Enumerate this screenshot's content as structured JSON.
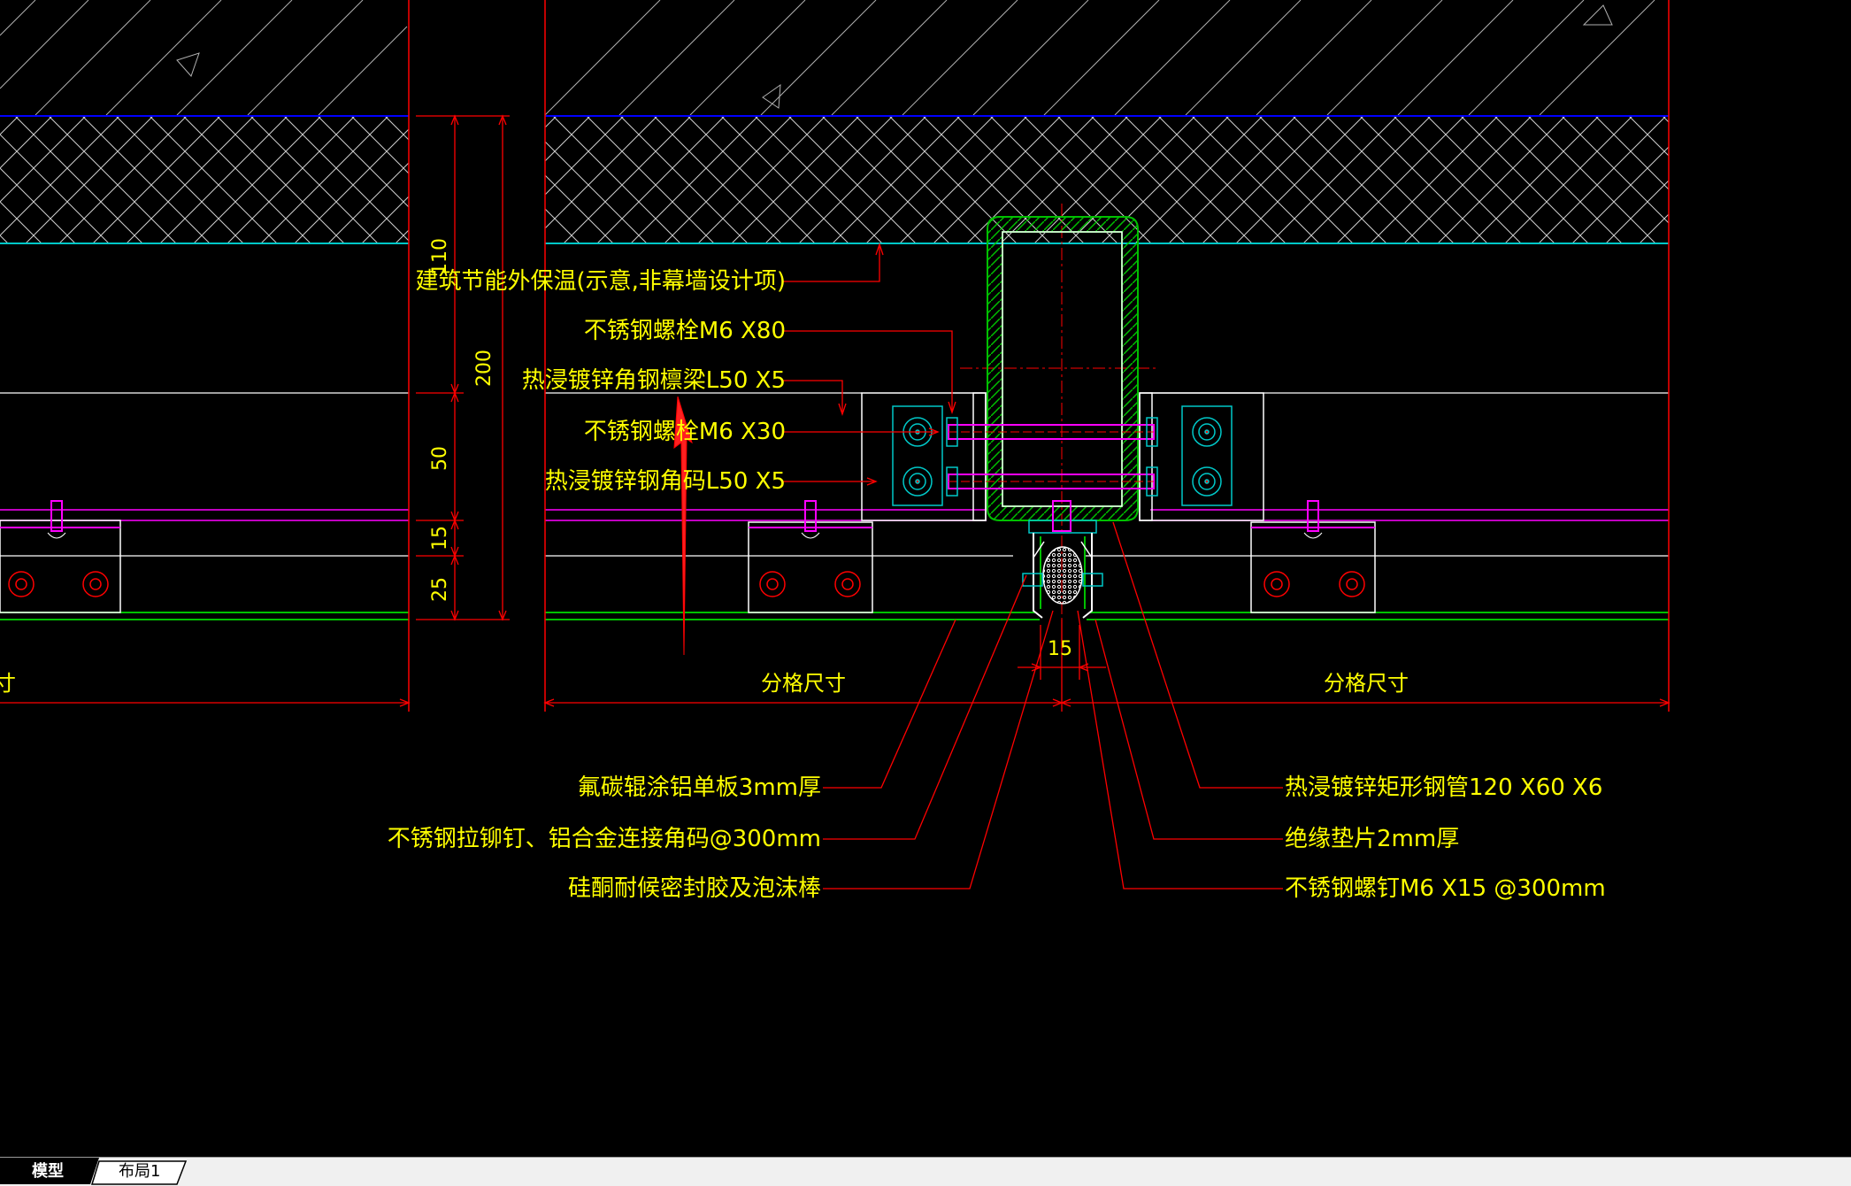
{
  "drawing": {
    "annotations": {
      "insulation": "建筑节能外保温(示意,非幕墙设计项)",
      "bolt_m6x80": "不锈钢螺栓M6 X80",
      "purlin": "热浸镀锌角钢檩梁L50 X5",
      "bolt_m6x30": "不锈钢螺栓M6 X30",
      "angle_code": "热浸镀锌钢角码L50 X5",
      "panel": "氟碳辊涂铝单板3mm厚",
      "rivet": "不锈钢拉铆钉、铝合金连接角码@300mm",
      "sealant": "硅酮耐候密封胶及泡沫棒",
      "tube": "热浸镀锌矩形钢管120 X60 X6",
      "gasket": "绝缘垫片2mm厚",
      "screw": "不锈钢螺钉M6 X15 @300mm"
    },
    "dimensions": {
      "d110": "110",
      "d200": "200",
      "d50": "50",
      "d15_left": "15",
      "d25": "25",
      "d15_joint": "15",
      "grid_left": "分格尺寸",
      "grid_right": "分格尺寸",
      "grid_far_left": "寸"
    },
    "colors": {
      "background": "#000000",
      "red": "#ff0000",
      "yellow": "#ffff00",
      "white": "#ffffff",
      "blue": "#0000ff",
      "cyan": "#00c8c8",
      "magenta": "#ff00ff",
      "green": "#00c000"
    }
  },
  "tabs": {
    "model": "模型",
    "layout1": "布局1"
  }
}
